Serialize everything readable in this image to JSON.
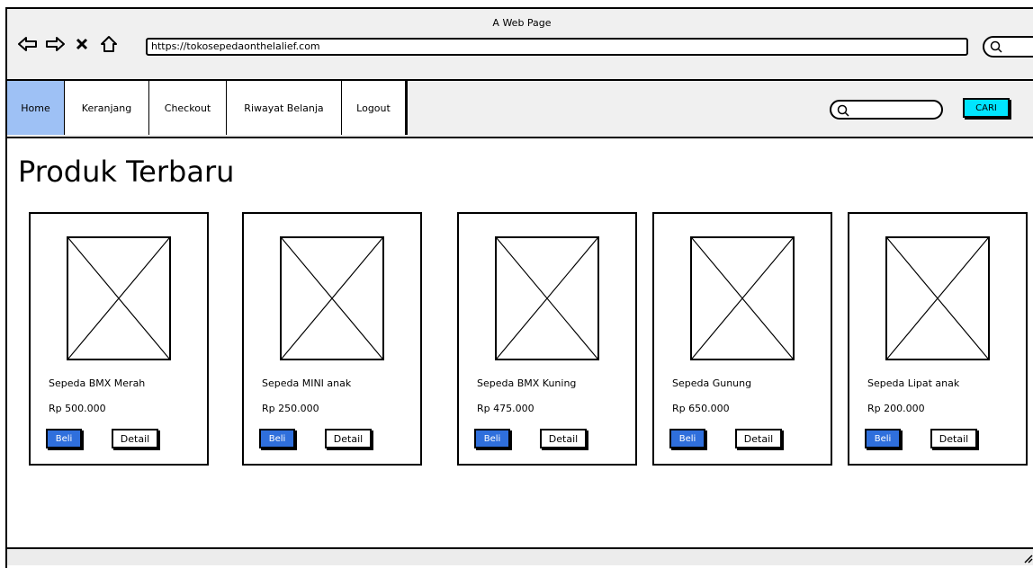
{
  "window": {
    "title": "A Web Page"
  },
  "browser": {
    "url": "https://tokosepedaonthelalief.com"
  },
  "nav": {
    "items": [
      {
        "label": "Home",
        "active": true
      },
      {
        "label": "Keranjang"
      },
      {
        "label": "Checkout"
      },
      {
        "label": "Riwayat Belanja"
      },
      {
        "label": "Logout"
      }
    ],
    "search_button": "CARI"
  },
  "main": {
    "heading": "Produk Terbaru",
    "products": [
      {
        "name": "Sepeda BMX Merah",
        "price": "Rp 500.000",
        "buy_label": "Beli",
        "detail_label": "Detail"
      },
      {
        "name": "Sepeda MINI anak",
        "price": "Rp 250.000",
        "buy_label": "Beli",
        "detail_label": "Detail"
      },
      {
        "name": "Sepeda BMX Kuning",
        "price": "Rp 475.000",
        "buy_label": "Beli",
        "detail_label": "Detail"
      },
      {
        "name": "Sepeda Gunung",
        "price": "Rp 650.000",
        "buy_label": "Beli",
        "detail_label": "Detail"
      },
      {
        "name": "Sepeda Lipat anak",
        "price": "Rp 200.000",
        "buy_label": "Beli",
        "detail_label": "Detail"
      }
    ]
  },
  "colors": {
    "active_nav": "#9ec1f5",
    "buy_button": "#2f6fdc",
    "search_button": "#00e5ff"
  }
}
